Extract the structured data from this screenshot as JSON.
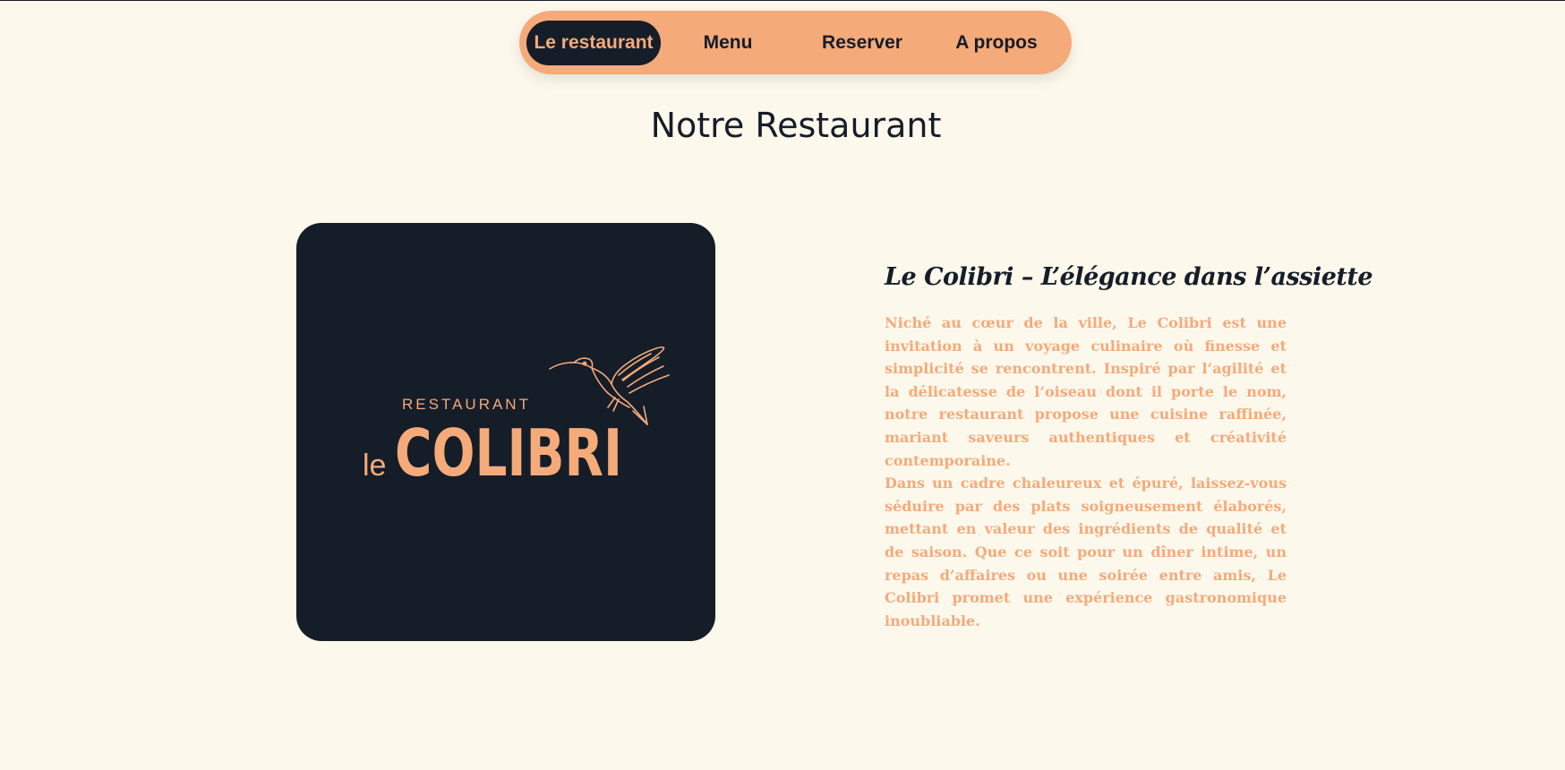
{
  "nav": {
    "items": [
      {
        "label": "Le restaurant",
        "active": true
      },
      {
        "label": "Menu",
        "active": false
      },
      {
        "label": "Reserver",
        "active": false
      },
      {
        "label": "A propos",
        "active": false
      }
    ]
  },
  "page": {
    "title": "Notre Restaurant"
  },
  "logo": {
    "small_text": "RESTAURANT",
    "prefix": "le",
    "name": "COLIBRI",
    "icon": "hummingbird-icon"
  },
  "about": {
    "heading": "Le Colibri – L’élégance dans l’assiette",
    "paragraph_1": "Niché au cœur de la ville, Le Colibri est une invitation à un voyage culinaire où finesse et simplicité se rencontrent. Inspiré par l’agilité et la délicatesse de l’oiseau dont il porte le nom, notre restaurant propose une cuisine raffinée, mariant saveurs authentiques et créativité contemporaine.",
    "paragraph_2": "Dans un cadre chaleureux et épuré, laissez-vous séduire par des plats soigneusement élaborés, mettant en valeur des ingrédients de qualité et de saison. Que ce soit pour un dîner intime, un repas d’affaires ou une soirée entre amis, Le Colibri promet une expérience gastronomique inoubliable."
  },
  "colors": {
    "background": "#fdf8ec",
    "accent": "#f5aa7a",
    "dark": "#151d29"
  }
}
